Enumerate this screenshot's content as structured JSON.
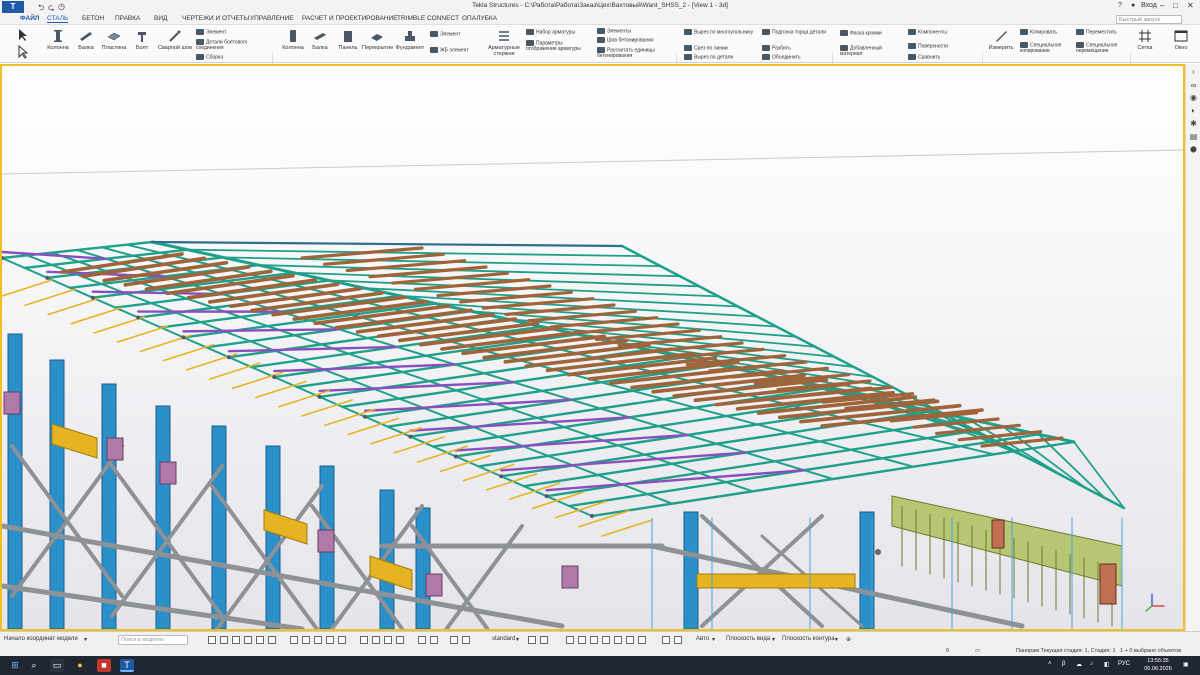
{
  "window": {
    "logo": "T",
    "title": "Tekla Structures - C:\\Работа\\Работа\\Заказ\\Цех\\Вахтовый\\Want_SHSS_2 - [View 1 - 3d]",
    "login": "Вход",
    "quick_access": [
      "⮌",
      "⮎",
      "◷"
    ]
  },
  "menu": {
    "tabs": [
      "ФАЙЛ",
      "СТАЛЬ",
      "БЕТОН",
      "ПРАВКА",
      "ВИД",
      "ЧЕРТЕЖИ И ОТЧЕТЫ",
      "УПРАВЛЕНИЕ",
      "РАСЧЕТ И ПРОЕКТИРОВАНИЕ",
      "TRIMBLE CONNECT",
      "ОПАЛУБКА"
    ],
    "search_placeholder": "Быстрый запуск"
  },
  "ribbon": {
    "steel": [
      {
        "label": "Колонна",
        "icon": "column-icon"
      },
      {
        "label": "Балка",
        "icon": "beam-icon"
      },
      {
        "label": "Пластина",
        "icon": "plate-icon"
      },
      {
        "label": "Болт",
        "icon": "bolt-icon"
      },
      {
        "label": "Сварной шов",
        "icon": "weld-icon"
      }
    ],
    "steel_small": [
      "Элемент",
      "Детали болтового соединения",
      "Сборка"
    ],
    "concrete": [
      {
        "label": "Колонна",
        "icon": "concrete-column-icon"
      },
      {
        "label": "Балка",
        "icon": "concrete-beam-icon"
      },
      {
        "label": "Панель",
        "icon": "panel-icon"
      },
      {
        "label": "Перекрытие",
        "icon": "slab-icon"
      },
      {
        "label": "Фундамент",
        "icon": "footing-icon"
      }
    ],
    "concrete_small": [
      "Элемент",
      "ЖБ элемент"
    ],
    "rebar": {
      "big": "Арматурные стержни",
      "small": [
        "Набор арматуры",
        "Параметры отображения арматуры",
        "Элементы",
        "Шов бетонирования",
        "Рассчитать единицы бетонирования"
      ]
    },
    "edit": [
      "Вырез по многоугольнику",
      "Срез по линии",
      "Вырез по детали",
      "Подгонка торца детали",
      "Разбить",
      "Объединить"
    ],
    "draw": {
      "big": "Фаска кромки",
      "small": [
        "Добавленный материал"
      ]
    },
    "components": [
      "Компоненты",
      "Поверхности",
      "Сравнить"
    ],
    "measure": "Измерить",
    "copy_move": [
      "Копировать",
      "Специальное копирование",
      "Переместить",
      "Специальное перемещение"
    ],
    "grid": "Сетка",
    "window_btn": "Окно"
  },
  "status": {
    "coord_origin": "Начало координат модели",
    "search_placeholder": "Поиск в моделях",
    "filter": "standard",
    "auto": "Авто",
    "view_plane": "Плоскость вида",
    "contour_plane": "Плоскость контура",
    "counter": "0",
    "pan_hint": "Панорам Текущая стадия: 1, Стадия: 1",
    "selected": "1 + 0 выбрано объектов"
  },
  "taskbar": {
    "lang": "РУС",
    "time": "13:55:35",
    "date": "05.06.2026"
  },
  "colors": {
    "accent": "#1f5aa6",
    "truss": "#1fa08a",
    "diagonal": "#8a4fbf",
    "purlin": "#a0643a",
    "column": "#2b8fc9",
    "crane_beam": "#e6b422",
    "viewport_border": "#f0c020"
  }
}
